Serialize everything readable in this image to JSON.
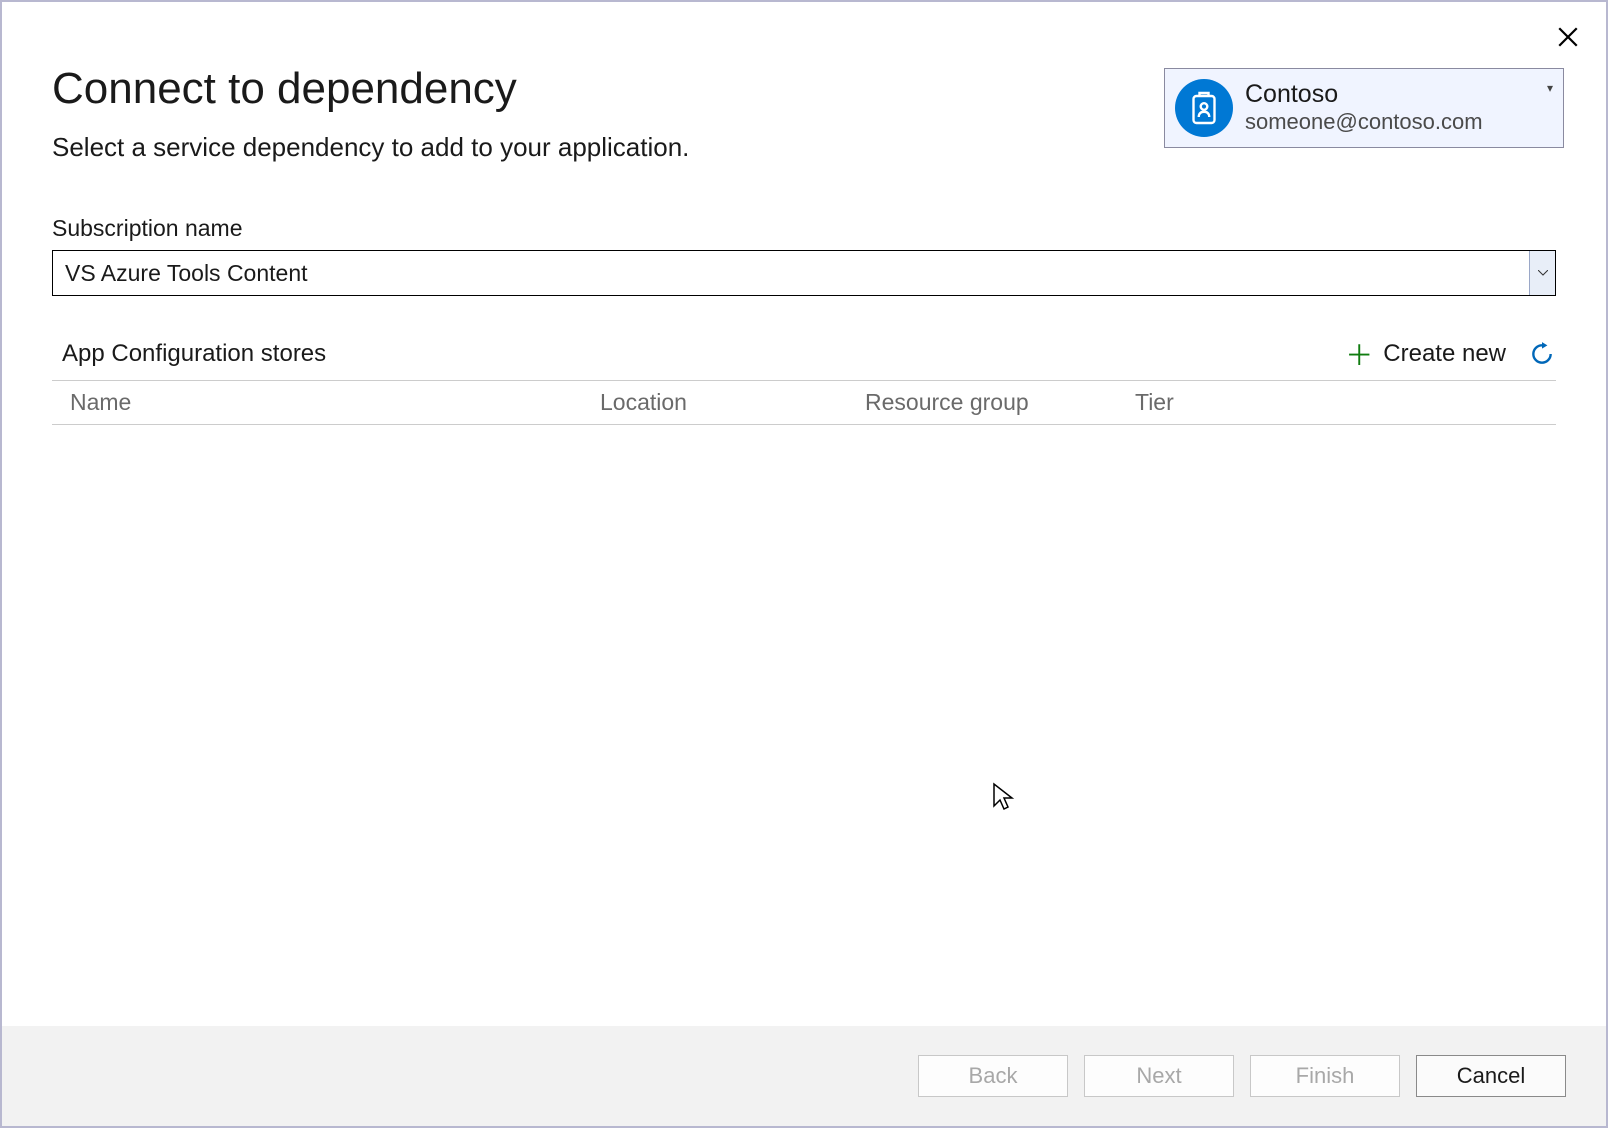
{
  "dialog": {
    "title": "Connect to dependency",
    "subtitle": "Select a service dependency to add to your application."
  },
  "account": {
    "name": "Contoso",
    "email": "someone@contoso.com"
  },
  "subscription": {
    "label": "Subscription name",
    "value": "VS Azure Tools Content"
  },
  "stores": {
    "title": "App Configuration stores",
    "create_new": "Create new",
    "columns": {
      "name": "Name",
      "location": "Location",
      "resource_group": "Resource group",
      "tier": "Tier"
    },
    "rows": []
  },
  "footer": {
    "back": "Back",
    "next": "Next",
    "finish": "Finish",
    "cancel": "Cancel"
  }
}
